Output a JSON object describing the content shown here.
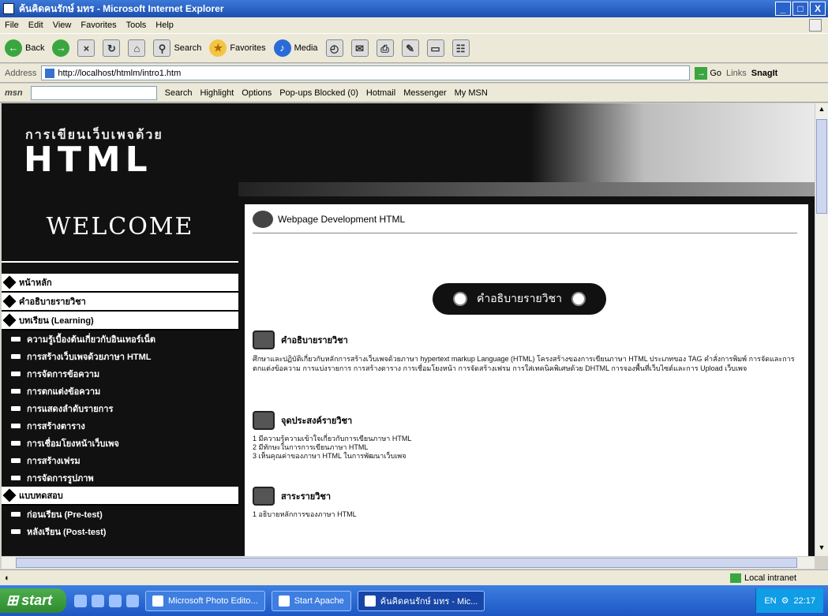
{
  "window": {
    "title": "ค้นคิดคนรักษ์ มทร - Microsoft Internet Explorer",
    "controls": [
      "_",
      "□",
      "X"
    ]
  },
  "menubar": [
    "File",
    "Edit",
    "View",
    "Favorites",
    "Tools",
    "Help"
  ],
  "toolbar": {
    "back": "Back",
    "search": "Search",
    "favorites": "Favorites",
    "media": "Media"
  },
  "address": {
    "label": "Address",
    "url": "http://localhost/htmlm/intro1.htm",
    "go": "Go",
    "links": "Links",
    "snagit": "SnagIt"
  },
  "msnbar": {
    "logo": "msn",
    "search": "Search",
    "highlight": "Highlight",
    "options": "Options",
    "popups": "Pop-ups Blocked (0)",
    "hotmail": "Hotmail",
    "messenger": "Messenger",
    "mymsn": "My MSN"
  },
  "banner": {
    "title_top": "การเขียนเว็บเพจด้วย",
    "title_main": "HTML"
  },
  "sidebar": {
    "welcome": "WELCOME",
    "heads": [
      "หน้าหลัก",
      "คำอธิบายรายวิชา",
      "บทเรียน (Learning)"
    ],
    "lessons": [
      "ความรู้เบื้องต้นเกี่ยวกับอินเทอร์เน็ต",
      "การสร้างเว็บเพจด้วยภาษา HTML",
      "การจัดการข้อความ",
      "การตกแต่งข้อความ",
      "การแสดงลำดับรายการ",
      "การสร้างตาราง",
      "การเชื่อมโยงหน้าเว็บเพจ",
      "การสร้างเฟรม",
      "การจัดการรูปภาพ"
    ],
    "test_head": "แบบทดสอบ",
    "tests": [
      "ก่อนเรียน (Pre-test)",
      "หลังเรียน (Post-test)"
    ]
  },
  "main": {
    "header": "Webpage Development HTML",
    "pill": "คำอธิบายรายวิชา",
    "sec1_title": "คำอธิบายรายวิชา",
    "sec1_body": "ศึกษาและปฏิบัติเกี่ยวกับหลักการสร้างเว็บเพจด้วยภาษา hypertext markup Language (HTML) โครงสร้างของการเขียนภาษา HTML ประเภทของ TAG คำสั่งการพิมพ์ การจัดและการตกแต่งข้อความ การแบ่งรายการ การสร้างตาราง การเชื่อมโยงหน้า การจัดสร้างเฟรม การใส่เทคนิคพิเศษด้วย DHTML การจองพื้นที่เว็บไซต์และการ Upload เว็บเพจ",
    "sec2_title": "จุดประสงค์รายวิชา",
    "sec2_items": [
      "1 มีความรู้ความเข้าใจเกี่ยวกับการเขียนภาษา HTML",
      "2 มีทักษะในการการเขียนภาษา HTML",
      "3 เห็นคุณค่าของภาษา HTML ในการพัฒนาเว็บเพจ"
    ],
    "sec3_title": "สาระรายวิชา",
    "sec3_items": [
      "1 อธิบายหลักการของภาษา HTML"
    ]
  },
  "status": {
    "zone": "Local intranet"
  },
  "taskbar": {
    "start": "start",
    "tasks": [
      "Microsoft Photo Edito...",
      "Start Apache",
      "ค้นคิดคนรักษ์ มทร - Mic..."
    ],
    "lang": "EN",
    "time": "22:17"
  }
}
